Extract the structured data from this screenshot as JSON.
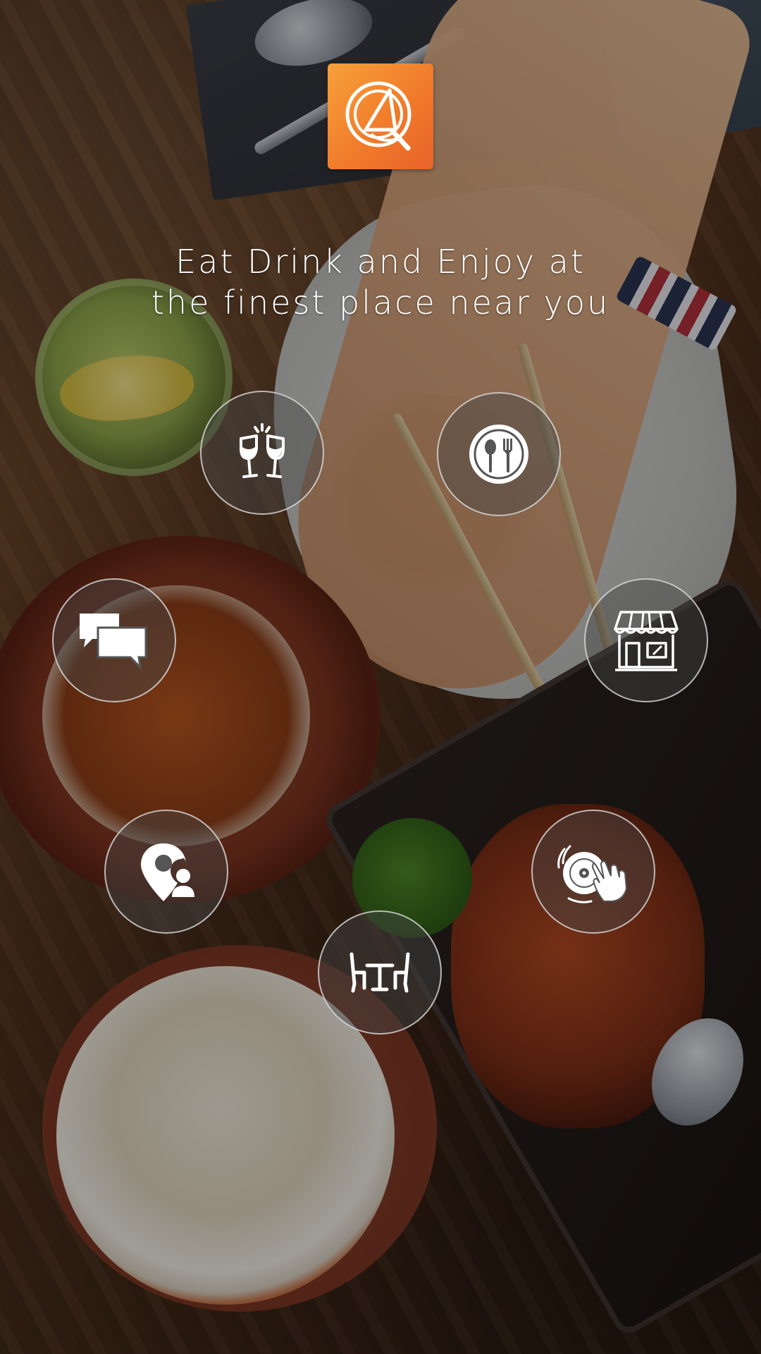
{
  "screen": {
    "tagline_line1": "Eat Drink and Enjoy at",
    "tagline_line2": "the finest place near you"
  },
  "logo": {
    "icon": "plate-cutlery-logo-icon",
    "colors": [
      "#f7a13a",
      "#e8632a"
    ]
  },
  "feature_buttons": [
    {
      "icon": "cheers-glasses-icon"
    },
    {
      "icon": "plate-spoon-fork-icon"
    },
    {
      "icon": "chat-bubbles-icon"
    },
    {
      "icon": "storefront-icon"
    },
    {
      "icon": "location-user-pin-icon"
    },
    {
      "icon": "dj-disc-hand-icon"
    },
    {
      "icon": "table-chairs-icon"
    }
  ]
}
